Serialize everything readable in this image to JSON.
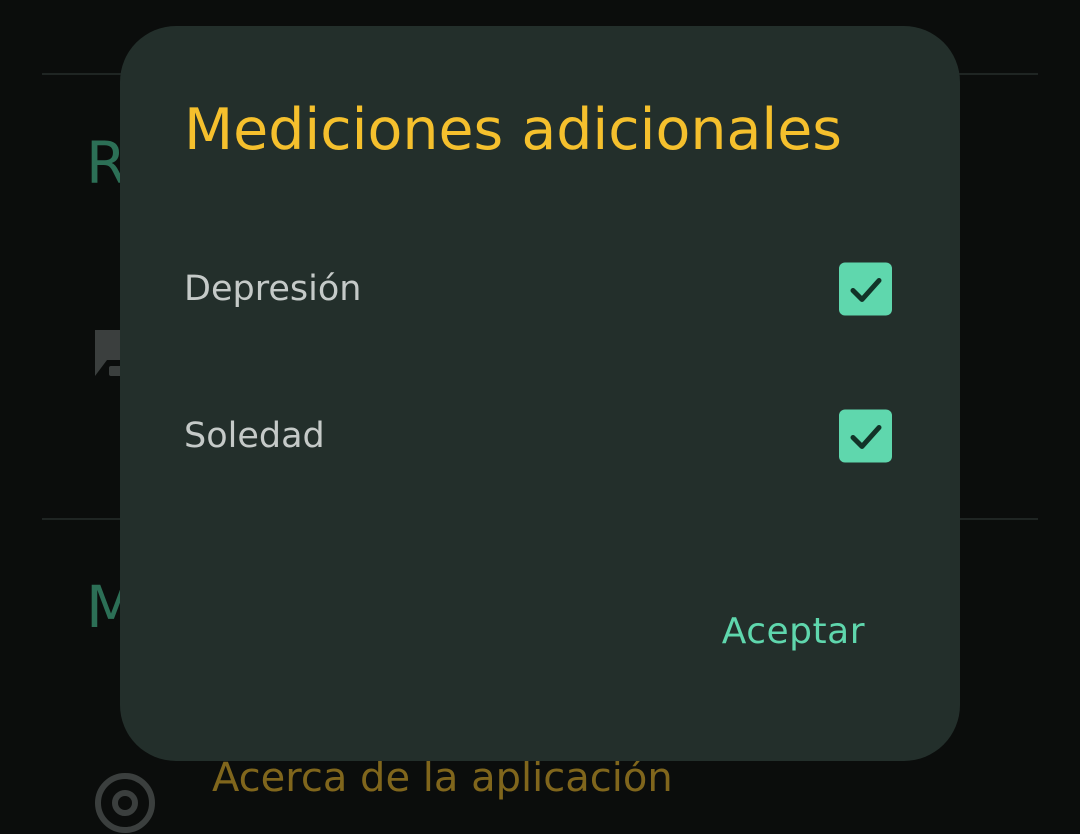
{
  "background": {
    "section_1_header": "R",
    "section_2_header": "M",
    "about_label": "Acerca de la aplicación"
  },
  "dialog": {
    "title": "Mediciones adicionales",
    "options": [
      {
        "label": "Depresión",
        "checked": true
      },
      {
        "label": "Soledad",
        "checked": true
      }
    ],
    "accept_label": "Aceptar"
  },
  "colors": {
    "accent": "#5fd7ad",
    "title": "#f5c02d",
    "dialog_bg": "#232f2b",
    "screen_bg": "#0b0d0c"
  },
  "icons": {
    "bg_item": "feedback-icon",
    "bg_about": "info-icon",
    "checkbox_mark": "check-icon"
  }
}
